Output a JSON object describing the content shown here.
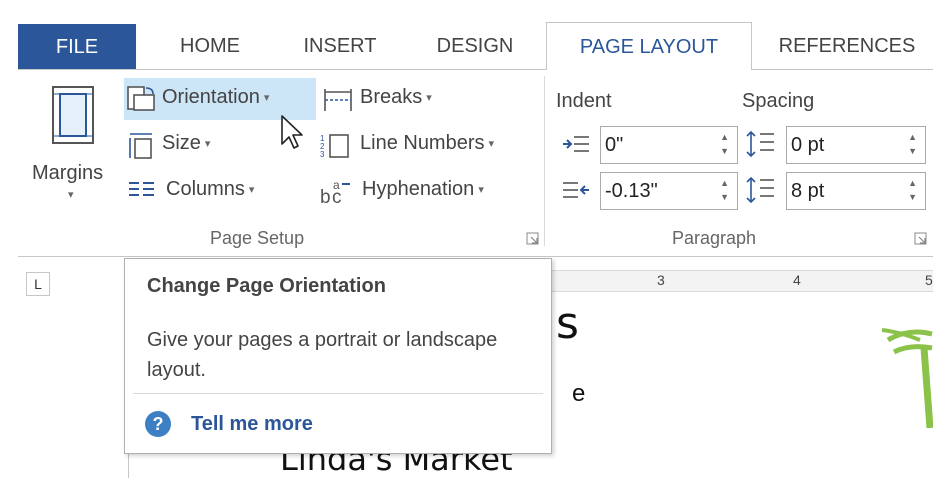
{
  "tabs": {
    "file": "FILE",
    "home": "HOME",
    "insert": "INSERT",
    "design": "DESIGN",
    "page_layout": "PAGE LAYOUT",
    "references": "REFERENCES"
  },
  "ribbon": {
    "page_setup": {
      "margins": "Margins",
      "orientation": "Orientation",
      "size": "Size",
      "columns": "Columns",
      "breaks": "Breaks",
      "line_numbers": "Line Numbers",
      "hyphenation": "Hyphenation",
      "group_label": "Page Setup"
    },
    "paragraph": {
      "indent_label": "Indent",
      "spacing_label": "Spacing",
      "indent_left": "0\"",
      "indent_right": "-0.13\"",
      "spacing_before": "0 pt",
      "spacing_after": "8 pt",
      "group_label": "Paragraph"
    }
  },
  "ruler": {
    "tab_selector": "L",
    "marks": [
      "3",
      "4",
      "5"
    ]
  },
  "document": {
    "heading_fragment": "s",
    "line_fragment": "e",
    "name_fragment": "Linda's Market"
  },
  "tooltip": {
    "title": "Change Page Orientation",
    "description": "Give your pages a portrait or landscape layout.",
    "link": "Tell me more",
    "help_icon_glyph": "?"
  },
  "icons": {
    "margins": "margins-icon",
    "orientation": "orientation-icon",
    "size": "size-icon",
    "columns": "columns-icon",
    "breaks": "breaks-icon",
    "line_numbers": "line-numbers-icon",
    "hyphenation": "hyphenation-icon",
    "indent_left": "indent-left-icon",
    "indent_right": "indent-right-icon",
    "spacing_before": "spacing-before-icon",
    "spacing_after": "spacing-after-icon",
    "help": "help-icon",
    "cursor": "mouse-cursor-icon"
  },
  "colors": {
    "file_tab": "#2b579a",
    "accent": "#2b579a",
    "highlight": "#cde6f7",
    "decoration_green": "#8bc34a"
  }
}
